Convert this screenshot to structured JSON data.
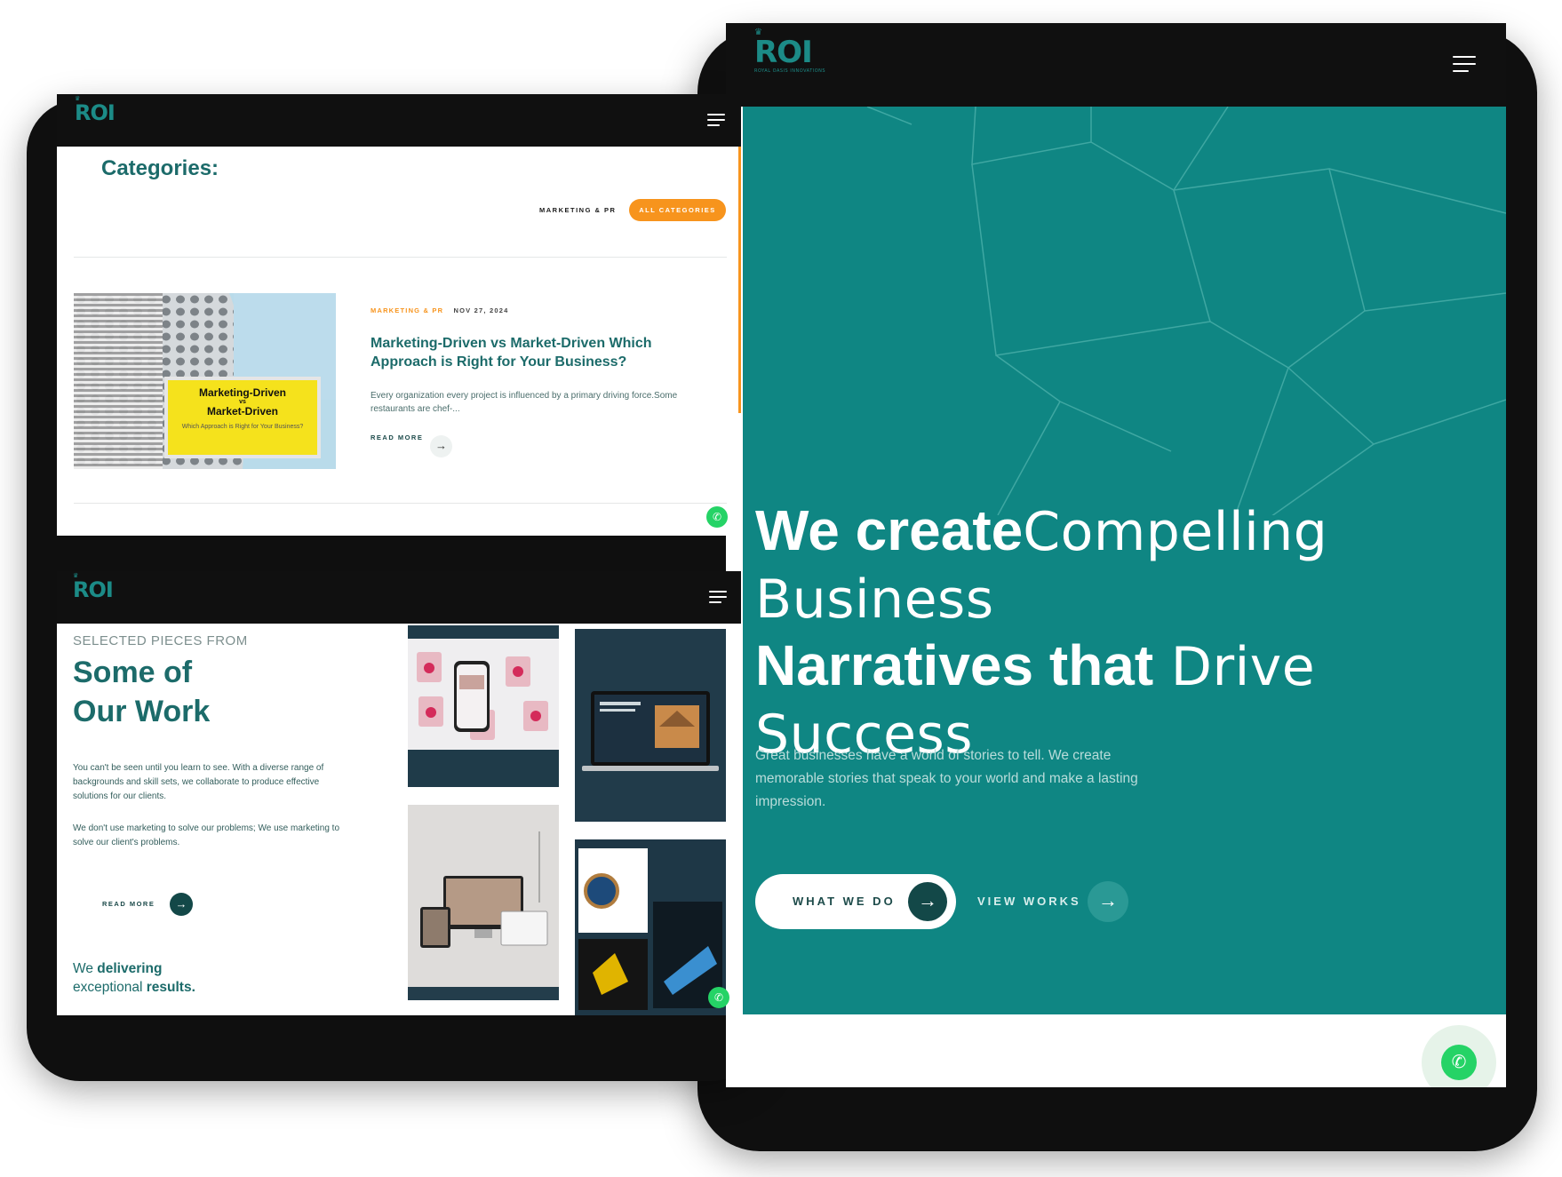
{
  "brand": {
    "logo": "ROI",
    "logo_sub": "ROYAL OASIS INNOVATIONS",
    "teal": "#0f8683",
    "dark_teal": "#1c6b6a",
    "orange": "#f7941d"
  },
  "hero": {
    "title_line1_bold": "We create",
    "title_line1_light": "Compelling",
    "title_line2_light": "Business",
    "title_line3_bold": "Narratives that",
    "title_line3_light": " Drive Success",
    "description": "Great businesses have a world of stories to tell. We create memorable stories that speak to your world and make a lasting impression.",
    "btn_primary": "WHAT WE DO",
    "btn_secondary": "VIEW WORKS"
  },
  "blog": {
    "heading": "Categories:",
    "chip_marketing": "MARKETING & PR",
    "chip_all": "ALL CATEGORIES",
    "post": {
      "category": "MARKETING & PR",
      "date": "NOV 27, 2024",
      "title": "Marketing-Driven vs Market-Driven Which Approach is Right for Your Business?",
      "excerpt": "Every organization every project is influenced by a primary driving force.Some restaurants are chef-...",
      "read_more": "READ MORE",
      "image_heading_1": "Marketing-Driven",
      "image_vs": "vs",
      "image_heading_2": "Market-Driven",
      "image_sub": "Which Approach is Right for Your Business?"
    }
  },
  "work": {
    "label": "SELECTED PIECES FROM",
    "title_line1": "Some of",
    "title_line2": "Our Work",
    "para1": "You can't be seen until you learn to see. With a diverse range of backgrounds and skill sets, we collaborate to produce effective solutions for our clients.",
    "para2": "We don't use marketing to solve our problems; We use marketing to solve our client's problems.",
    "read_more": "READ MORE",
    "tag_we": "We ",
    "tag_delivering": "delivering",
    "tag_exceptional": "exceptional ",
    "tag_results": "results."
  },
  "icons": [
    "hamburger-icon",
    "arrow-right-icon",
    "whatsapp-icon",
    "crown-icon"
  ]
}
